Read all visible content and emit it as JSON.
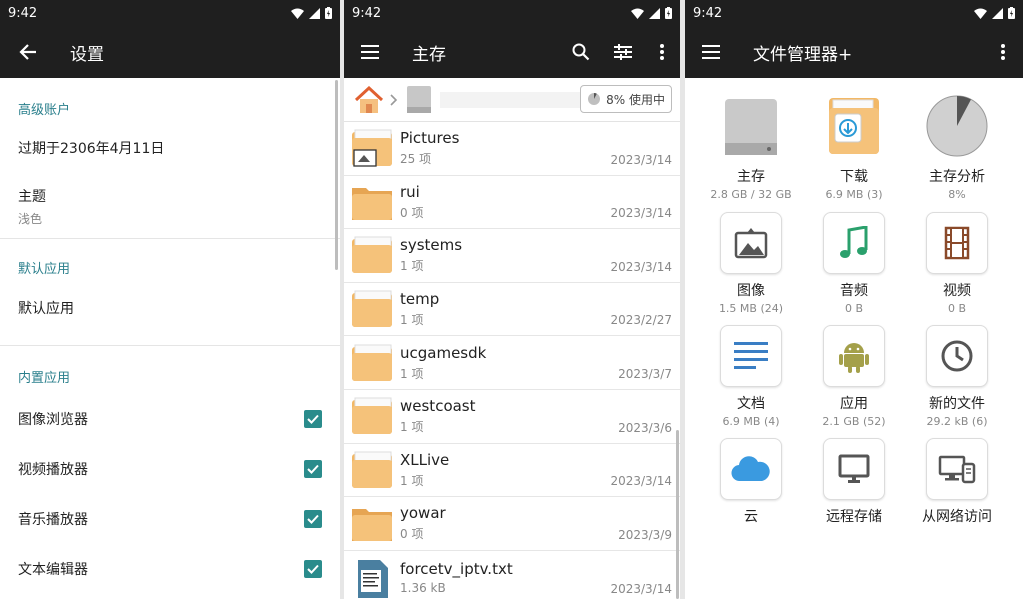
{
  "status_time": "9:42",
  "settings": {
    "title": "设置",
    "sections": {
      "advanced": "高级账户",
      "default_apps": "默认应用",
      "builtin": "内置应用"
    },
    "expire": "过期于2306年4月11日",
    "theme_label": "主题",
    "theme_value": "浅色",
    "default_app_item": "默认应用",
    "builtin_items": [
      "图像浏览器",
      "视频播放器",
      "音乐播放器",
      "文本编辑器"
    ]
  },
  "storage": {
    "title": "主存",
    "usage": "8% 使用中",
    "files": [
      {
        "name": "Pictures",
        "count": "25 项",
        "date": "2023/3/14"
      },
      {
        "name": "rui",
        "count": "0 项",
        "date": "2023/3/14"
      },
      {
        "name": "systems",
        "count": "1 项",
        "date": "2023/3/14"
      },
      {
        "name": "temp",
        "count": "1 项",
        "date": "2023/2/27"
      },
      {
        "name": "ucgamesdk",
        "count": "1 项",
        "date": "2023/3/7"
      },
      {
        "name": "westcoast",
        "count": "1 项",
        "date": "2023/3/6"
      },
      {
        "name": "XLLive",
        "count": "1 项",
        "date": "2023/3/14"
      },
      {
        "name": "yowar",
        "count": "0 项",
        "date": "2023/3/9"
      },
      {
        "name": "forcetv_iptv.txt",
        "count": "1.36 kB",
        "date": "2023/3/14"
      }
    ]
  },
  "home": {
    "title": "文件管理器+",
    "items": [
      {
        "label": "主存",
        "sub": "2.8 GB / 32 GB"
      },
      {
        "label": "下载",
        "sub": "6.9 MB (3)"
      },
      {
        "label": "主存分析",
        "sub": "8%"
      },
      {
        "label": "图像",
        "sub": "1.5 MB (24)"
      },
      {
        "label": "音频",
        "sub": "0 B"
      },
      {
        "label": "视频",
        "sub": "0 B"
      },
      {
        "label": "文档",
        "sub": "6.9 MB (4)"
      },
      {
        "label": "应用",
        "sub": "2.1 GB (52)"
      },
      {
        "label": "新的文件",
        "sub": "29.2 kB (6)"
      },
      {
        "label": "云",
        "sub": ""
      },
      {
        "label": "远程存储",
        "sub": ""
      },
      {
        "label": "从网络访问",
        "sub": ""
      }
    ]
  },
  "colors": {
    "accent": "#2a8c8c",
    "folder": "#f2b866",
    "bar": "#1f1f1f"
  }
}
